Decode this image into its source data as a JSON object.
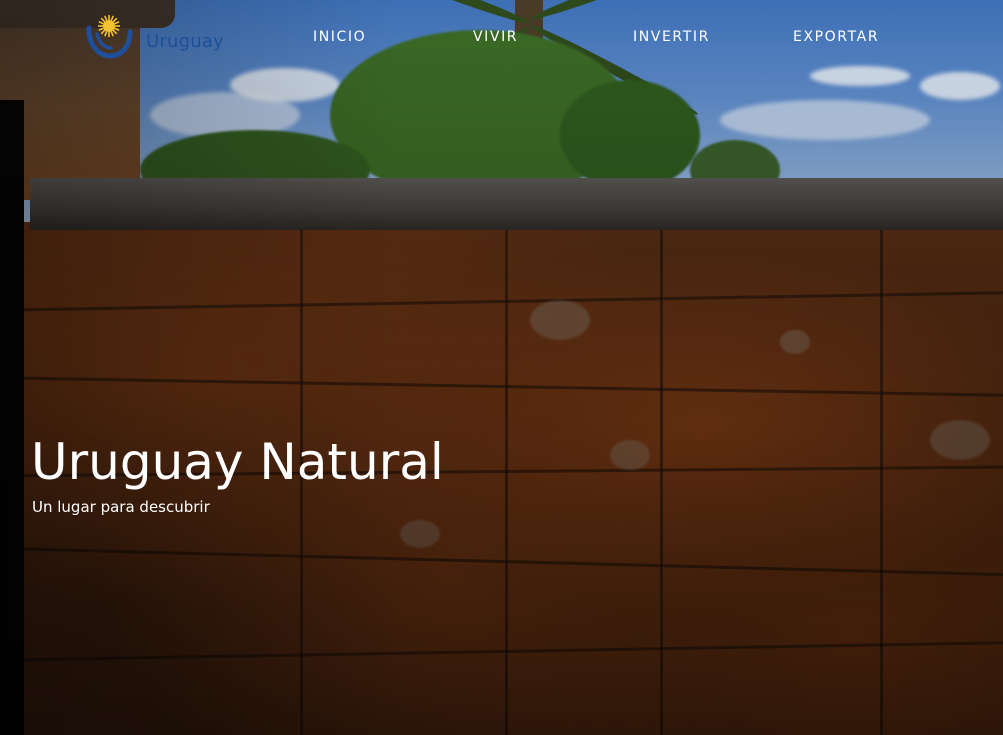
{
  "brand": {
    "logo_text": "Uruguay",
    "sun_color": "#f2c230",
    "emblem_color": "#1f4f9a"
  },
  "nav": {
    "items": [
      {
        "label": "INICIO"
      },
      {
        "label": "VIVIR"
      },
      {
        "label": "INVERTIR"
      },
      {
        "label": "EXPORTAR"
      }
    ]
  },
  "hero": {
    "title": "Uruguay Natural",
    "subtitle": "Un lugar para descubrir"
  }
}
